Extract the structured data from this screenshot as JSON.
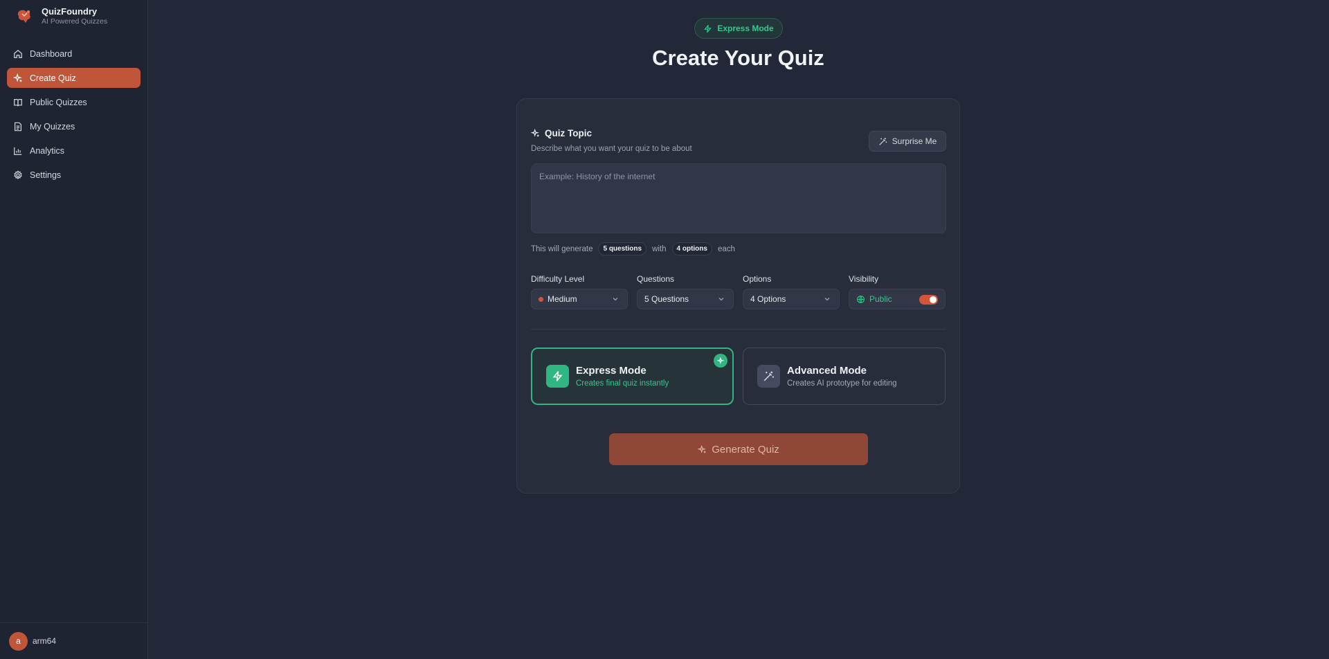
{
  "brand": {
    "name": "QuizFoundry",
    "tagline": "AI Powered Quizzes"
  },
  "sidebar": {
    "items": [
      {
        "label": "Dashboard",
        "icon": "home-icon"
      },
      {
        "label": "Create Quiz",
        "icon": "sparkles-icon",
        "active": true
      },
      {
        "label": "Public Quizzes",
        "icon": "book-open-icon"
      },
      {
        "label": "My Quizzes",
        "icon": "file-text-icon"
      },
      {
        "label": "Analytics",
        "icon": "bar-chart-icon"
      },
      {
        "label": "Settings",
        "icon": "gear-icon"
      }
    ],
    "user": {
      "initial": "a",
      "name": "arm64"
    }
  },
  "header": {
    "mode_pill": "Express Mode",
    "title": "Create Your Quiz"
  },
  "form": {
    "topic_title": "Quiz Topic",
    "topic_desc": "Describe what you want your quiz to be about",
    "surprise_label": "Surprise Me",
    "topic_placeholder": "Example: History of the internet",
    "topic_value": "",
    "gen_prefix": "This will generate",
    "gen_questions": "5 questions",
    "gen_with": "with",
    "gen_options": "4 options",
    "gen_suffix": "each",
    "difficulty": {
      "label": "Difficulty Level",
      "value": "Medium"
    },
    "questions": {
      "label": "Questions",
      "value": "5 Questions"
    },
    "options": {
      "label": "Options",
      "value": "4 Options"
    },
    "visibility": {
      "label": "Visibility",
      "value": "Public",
      "on": true
    }
  },
  "modes": {
    "express": {
      "title": "Express Mode",
      "subtitle": "Creates final quiz instantly",
      "selected": true
    },
    "advanced": {
      "title": "Advanced Mode",
      "subtitle": "Creates AI prototype for editing",
      "selected": false
    }
  },
  "generate_label": "Generate Quiz",
  "colors": {
    "accent": "#bf5539",
    "success": "#34c98c",
    "background": "#232838",
    "card": "#282d3c"
  }
}
